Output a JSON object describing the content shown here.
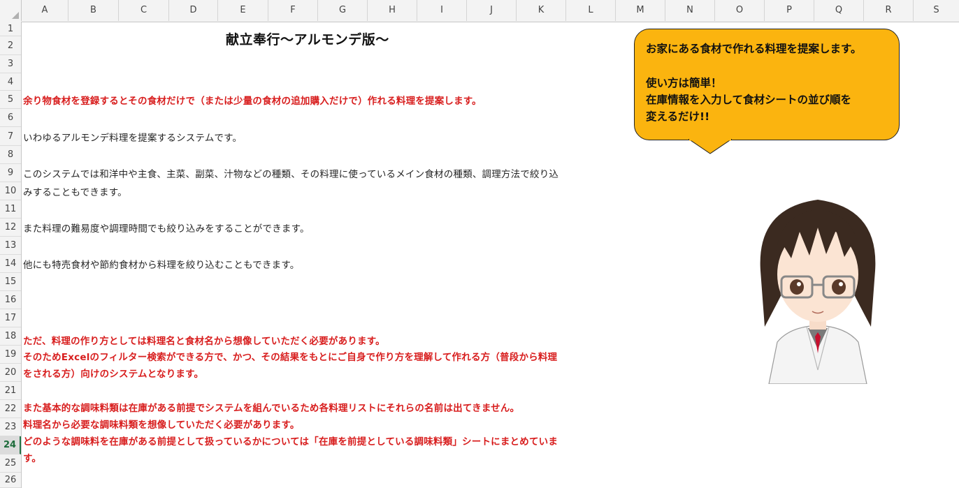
{
  "columns": [
    "A",
    "B",
    "C",
    "D",
    "E",
    "F",
    "G",
    "H",
    "I",
    "J",
    "K",
    "L",
    "M",
    "N",
    "O",
    "P",
    "Q",
    "R",
    "S"
  ],
  "rows": [
    "1",
    "2",
    "3",
    "4",
    "5",
    "6",
    "7",
    "8",
    "9",
    "10",
    "11",
    "12",
    "13",
    "14",
    "15",
    "16",
    "17",
    "18",
    "19",
    "20",
    "21",
    "22",
    "23",
    "24",
    "25",
    "26"
  ],
  "active_row": "24",
  "sheet": {
    "title": "献立奉行〜アルモンデ版〜",
    "row5": "余り物食材を登録するとその食材だけで（または少量の食材の追加購入だけで）作れる料理を提案します。",
    "row7": "いわゆるアルモンデ料理を提案するシステムです。",
    "row9": "このシステムでは和洋中や主食、主菜、副菜、汁物などの種類、その料理に使っているメイン食材の種類、調理方法で絞り込",
    "row10": "みすることもできます。",
    "row12": "また料理の難易度や調理時間でも絞り込みをすることができます。",
    "row14": "他にも特売食材や節約食材から料理を絞り込むこともできます。",
    "row18": "ただ、料理の作り方としては料理名と食材名から想像していただく必要があります。",
    "row19": "そのためExcelのフィルター検索ができる方で、かつ、その結果をもとにご自身で作り方を理解して作れる方（普段から料理",
    "row20": "をされる方）向けのシステムとなります。",
    "row22": "また基本的な調味料類は在庫がある前提でシステムを組んでいるため各料理リストにそれらの名前は出てきません。",
    "row23": "料理名から必要な調味料類を想像していただく必要があります。",
    "row24": "どのような調味料を在庫がある前提として扱っているかについては「在庫を前提としている調味料類」シートにまとめていま",
    "row25": "す。"
  },
  "bubble": {
    "line1": "お家にある食材で作れる料理を提案します。",
    "line2": "使い方は簡単！",
    "line3": "在庫情報を入力して食材シートの並び順を",
    "line4": "変えるだけ!!",
    "color": "#fbb40f"
  },
  "colors": {
    "red_text": "#d81e1e",
    "header_bg": "#f3f3f3"
  }
}
